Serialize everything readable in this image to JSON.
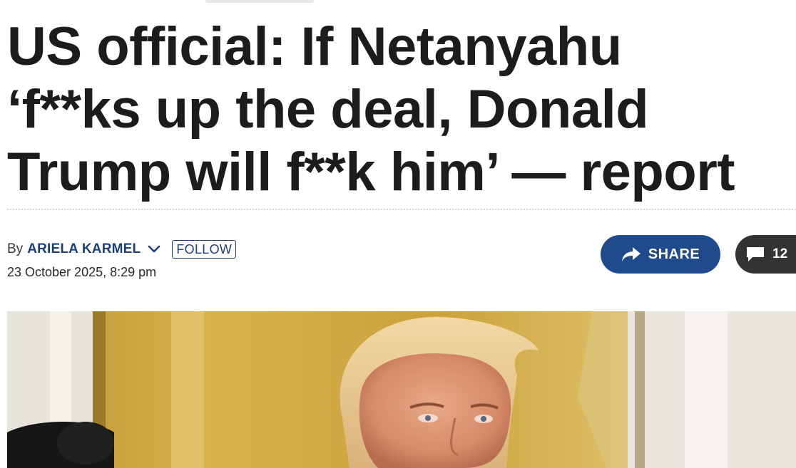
{
  "headline": {
    "line1": "US official: If Netanyahu",
    "line2": "‘f**ks up the deal, Donald",
    "line3": "Trump will f**k him’ — report"
  },
  "byline": {
    "by": "By",
    "author": "ARIELA KARMEL",
    "follow": "FOLLOW",
    "date": "23 October 2025, 8:29 pm"
  },
  "actions": {
    "share": "SHARE",
    "comments": "12"
  },
  "icons": {
    "author_menu": "chevron-down-icon",
    "share": "share-arrow-icon",
    "comments": "comment-bubble-icon"
  },
  "colors": {
    "headline": "#1c1c1c",
    "author_link": "#1e3f7a",
    "share_button": "#1f4b8e",
    "comment_button": "#333333"
  }
}
